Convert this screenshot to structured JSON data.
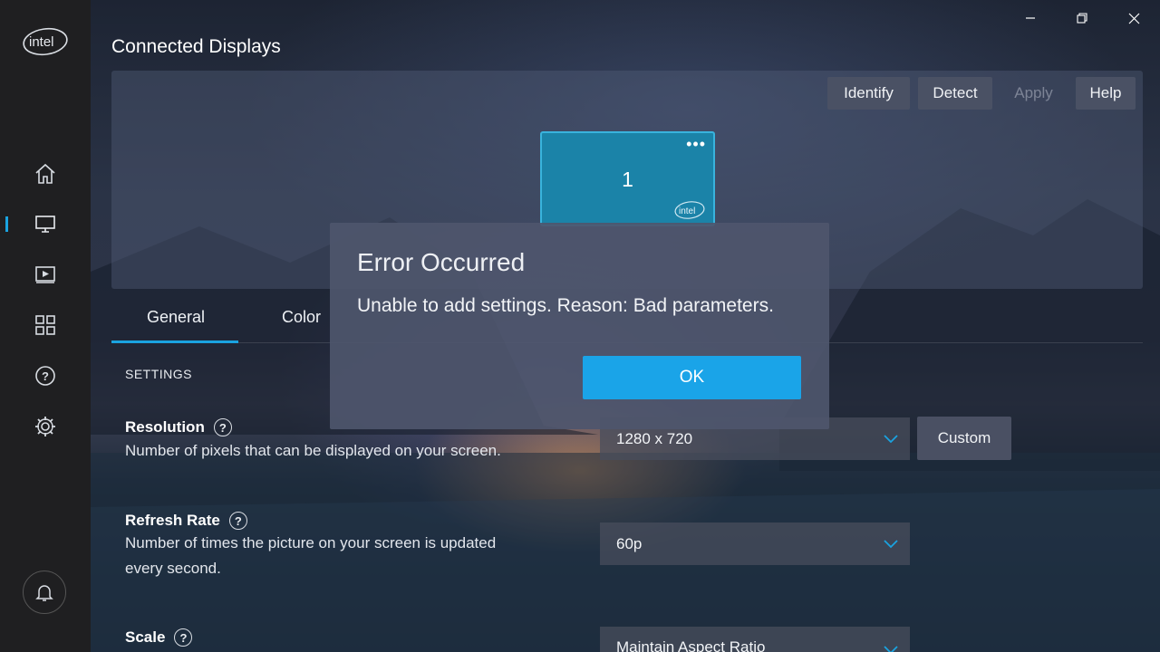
{
  "window": {
    "title": "Connected Displays",
    "controls": [
      "minimize-icon",
      "restore-icon",
      "close-icon"
    ]
  },
  "sidebar": {
    "logo_text": "intel",
    "items": [
      {
        "name": "home",
        "icon": "home-icon",
        "active": false
      },
      {
        "name": "display",
        "icon": "monitor-icon",
        "active": true
      },
      {
        "name": "video",
        "icon": "video-icon",
        "active": false
      },
      {
        "name": "apps",
        "icon": "grid-icon",
        "active": false
      },
      {
        "name": "help",
        "icon": "help-icon",
        "active": false
      },
      {
        "name": "settings",
        "icon": "gear-icon",
        "active": false
      }
    ],
    "notifications_icon": "bell-icon"
  },
  "toolbar": {
    "identify": "Identify",
    "detect": "Detect",
    "apply": "Apply",
    "help": "Help"
  },
  "preview": {
    "display_number": "1",
    "menu_glyph": "•••",
    "badge_text": "intel"
  },
  "tabs": [
    {
      "label": "General",
      "active": true
    },
    {
      "label": "Color",
      "active": false
    }
  ],
  "settings": {
    "section_label": "SETTINGS",
    "resolution": {
      "title": "Resolution",
      "description": "Number of pixels that can be displayed on your screen.",
      "value": "1280 x 720",
      "custom_label": "Custom"
    },
    "refresh_rate": {
      "title": "Refresh Rate",
      "description": "Number of times the picture on your screen is updated every second.",
      "value": "60p"
    },
    "scale": {
      "title": "Scale",
      "value": "Maintain Aspect Ratio"
    },
    "help_glyph": "?"
  },
  "dialog": {
    "title": "Error Occurred",
    "message": "Unable to add settings. Reason: Bad parameters.",
    "ok_label": "OK"
  },
  "colors": {
    "accent": "#1aa4e8",
    "sidebar_bg": "#1f1f21",
    "monitor_fill": "#1b83a8"
  }
}
